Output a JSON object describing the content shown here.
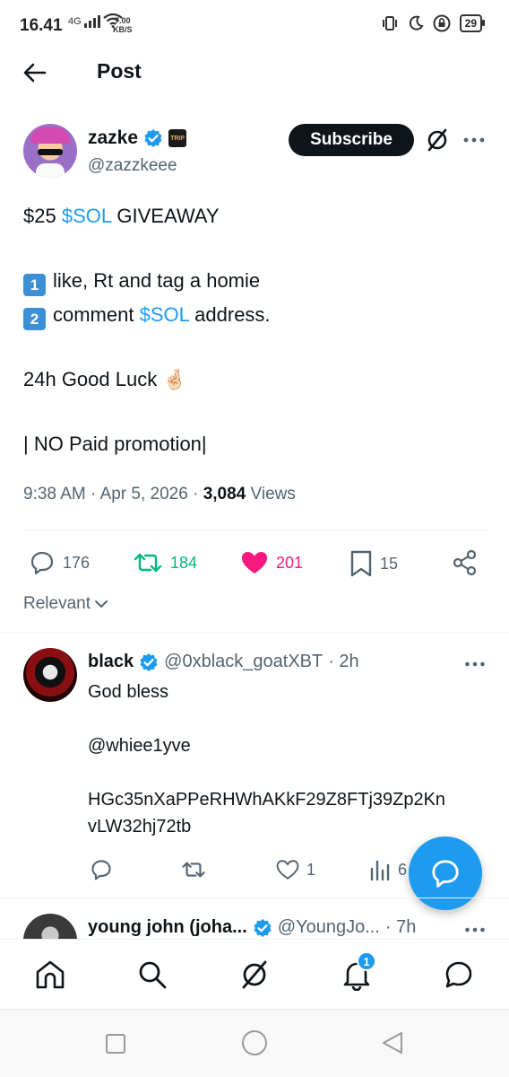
{
  "status_bar": {
    "time": "16.41",
    "network": "4G",
    "speed_value": "7.00",
    "speed_unit": "KB/S",
    "battery": "29"
  },
  "header": {
    "title": "Post"
  },
  "post": {
    "author_name": "zazke",
    "author_handle": "@zazzkeee",
    "affiliate_badge_text": "TRIP",
    "subscribe_label": "Subscribe",
    "line1_prefix": "$25 ",
    "line1_link": "$SOL",
    "line1_suffix": " GIVEAWAY",
    "item1_num": "1",
    "item1_text": "like, Rt and tag a homie",
    "item2_num": "2",
    "item2_text_prefix": "comment ",
    "item2_link": "$SOL",
    "item2_text_suffix": " address.",
    "line_luck": "24h Good Luck 🤞🏻",
    "line_promo": "| NO Paid promotion|",
    "time": "9:38 AM",
    "date": "Apr 5, 2026",
    "views_count": "3,084",
    "views_label": " Views",
    "replies": "176",
    "reposts": "184",
    "likes": "201",
    "bookmarks": "15"
  },
  "sort": {
    "label": "Relevant"
  },
  "replies": [
    {
      "name": "black",
      "handle": "@0xblack_goatXBT",
      "time": "· 2h",
      "text_line1": "God bless",
      "mention": "@whiee1yve",
      "address_line1": "HGc35nXaPPeRHWhAKkF29Z8FTj39Zp2Kn",
      "address_line2": "vLW32hj72tb",
      "likes": "1",
      "views": "6"
    },
    {
      "name": "young john (joha...",
      "handle": "@YoungJo...",
      "time": "· 7h"
    }
  ],
  "bottom_nav": {
    "notification_count": "1"
  },
  "colors": {
    "accent": "#1d9bf0",
    "repost": "#00ba7c",
    "like": "#f91880",
    "text": "#0f1419",
    "muted": "#536471"
  }
}
